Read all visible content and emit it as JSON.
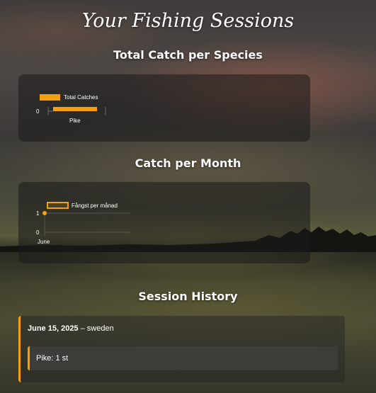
{
  "page": {
    "title": "Your Fishing Sessions"
  },
  "sections": {
    "species_title": "Total Catch per Species",
    "month_title": "Catch per Month",
    "history_title": "Session History"
  },
  "colors": {
    "accent": "#f5a00f"
  },
  "chart_data": [
    {
      "type": "bar",
      "orientation": "horizontal",
      "categories": [
        "Pike"
      ],
      "series": [
        {
          "name": "Total Catches",
          "values": [
            1
          ]
        }
      ],
      "x_tick_labels": [
        "0"
      ],
      "legend": "top-left"
    },
    {
      "type": "line",
      "categories": [
        "June"
      ],
      "series": [
        {
          "name": "Fångst per månad",
          "values": [
            1
          ]
        }
      ],
      "y_tick_labels": [
        "1",
        "0"
      ],
      "ylim": [
        0,
        1
      ],
      "legend": "top-left"
    }
  ],
  "history": {
    "session": {
      "date": "June 15, 2025",
      "separator": " – ",
      "location": "sweden",
      "catches": [
        {
          "text": "Pike: 1 st"
        }
      ]
    }
  }
}
